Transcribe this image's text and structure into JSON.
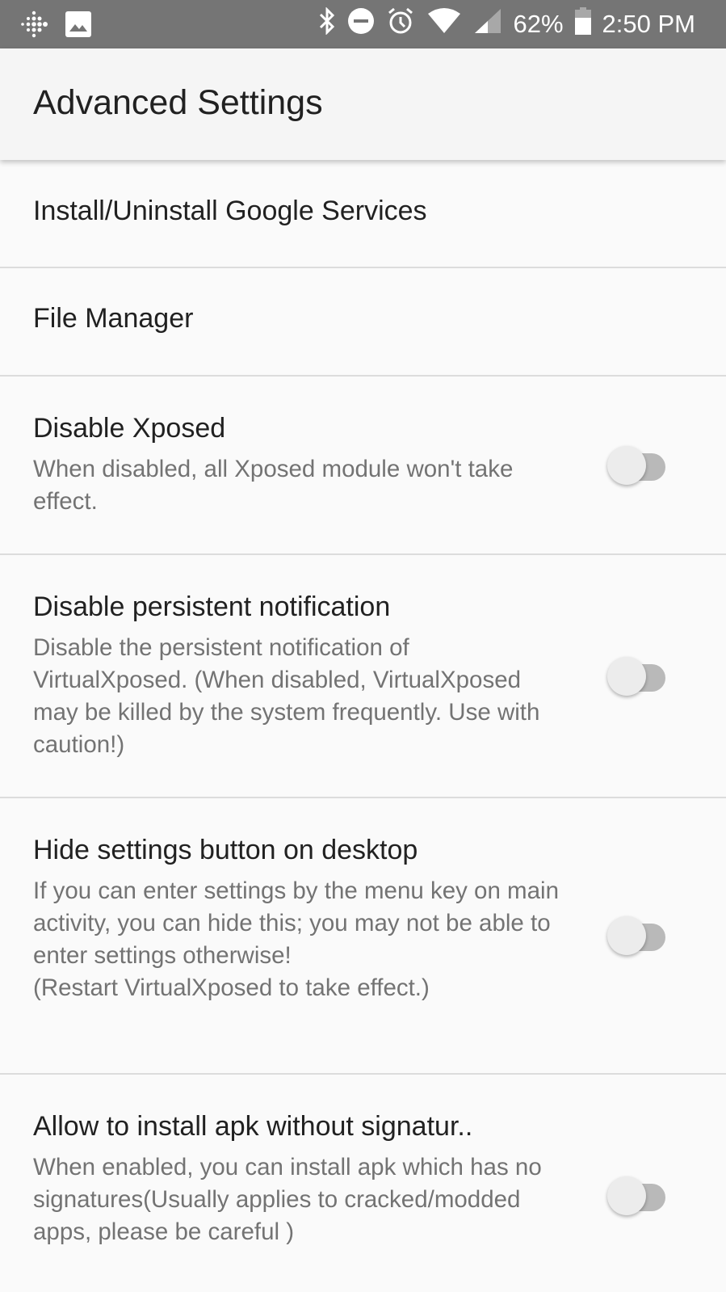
{
  "status_bar": {
    "left_icons": [
      "fitbit-icon",
      "image-icon"
    ],
    "right_icons": [
      "bluetooth-icon",
      "do-not-disturb-icon",
      "alarm-icon",
      "wifi-icon",
      "cell-signal-icon"
    ],
    "battery_percent": "62%",
    "time": "2:50 PM"
  },
  "app_bar": {
    "title": "Advanced Settings"
  },
  "settings": [
    {
      "title": "Install/Uninstall Google Services"
    },
    {
      "title": "File Manager"
    },
    {
      "title": "Disable Xposed",
      "summary": "When disabled, all Xposed module won't take effect.",
      "enabled": false
    },
    {
      "title": "Disable persistent notification",
      "summary": "Disable the persistent notification of VirtualXposed. (When disabled, VirtualXposed may be killed by the system frequently. Use with caution!)",
      "enabled": false
    },
    {
      "title": "Hide settings button on desktop",
      "summary": "If you can enter settings by the menu key on main activity, you can hide this; you may not be able to enter settings otherwise!\n(Restart VirtualXposed to take effect.)",
      "enabled": false
    },
    {
      "title": "Allow to install apk without signatur..",
      "summary": "When enabled, you can install apk which has no signatures(Usually applies to cracked/modded apps, please be careful )",
      "enabled": false
    }
  ],
  "colors": {
    "status_bar": "#757575",
    "app_bar": "#f5f5f5",
    "background": "#fafafa",
    "title_text": "#212121",
    "summary_text": "#737373",
    "switch_track_off": "#b9b9b9",
    "switch_thumb_off": "#ececec"
  }
}
